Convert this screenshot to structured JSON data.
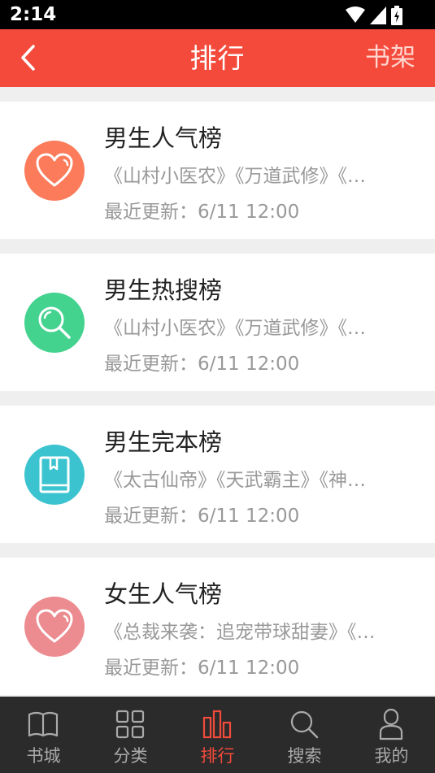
{
  "status": {
    "time": "2:14"
  },
  "header": {
    "title": "排行",
    "right_action": "书架"
  },
  "rankings": [
    {
      "name": "男生人气榜",
      "books": "《山村小医农》《万道武修》《…",
      "update": "最近更新：6/11 12:00",
      "icon": "heart-icon",
      "color": "#fb7b5a"
    },
    {
      "name": "男生热搜榜",
      "books": "《山村小医农》《万道武修》《…",
      "update": "最近更新：6/11 12:00",
      "icon": "search-icon",
      "color": "#43d38f"
    },
    {
      "name": "男生完本榜",
      "books": "《太古仙帝》《天武霸主》《神…",
      "update": "最近更新：6/11 12:00",
      "icon": "book-icon",
      "color": "#3bc4cf"
    },
    {
      "name": "女生人气榜",
      "books": "《总裁来袭：追宠带球甜妻》《…",
      "update": "最近更新：6/11 12:00",
      "icon": "heart-icon",
      "color": "#ec8b90"
    }
  ],
  "tabs": [
    {
      "label": "书城",
      "icon": "book-open-icon"
    },
    {
      "label": "分类",
      "icon": "grid-icon"
    },
    {
      "label": "排行",
      "icon": "bar-chart-icon",
      "active": true
    },
    {
      "label": "搜索",
      "icon": "search-icon"
    },
    {
      "label": "我的",
      "icon": "user-icon"
    }
  ],
  "colors": {
    "accent": "#f44a3b",
    "tabbar": "#2b2b2b"
  }
}
